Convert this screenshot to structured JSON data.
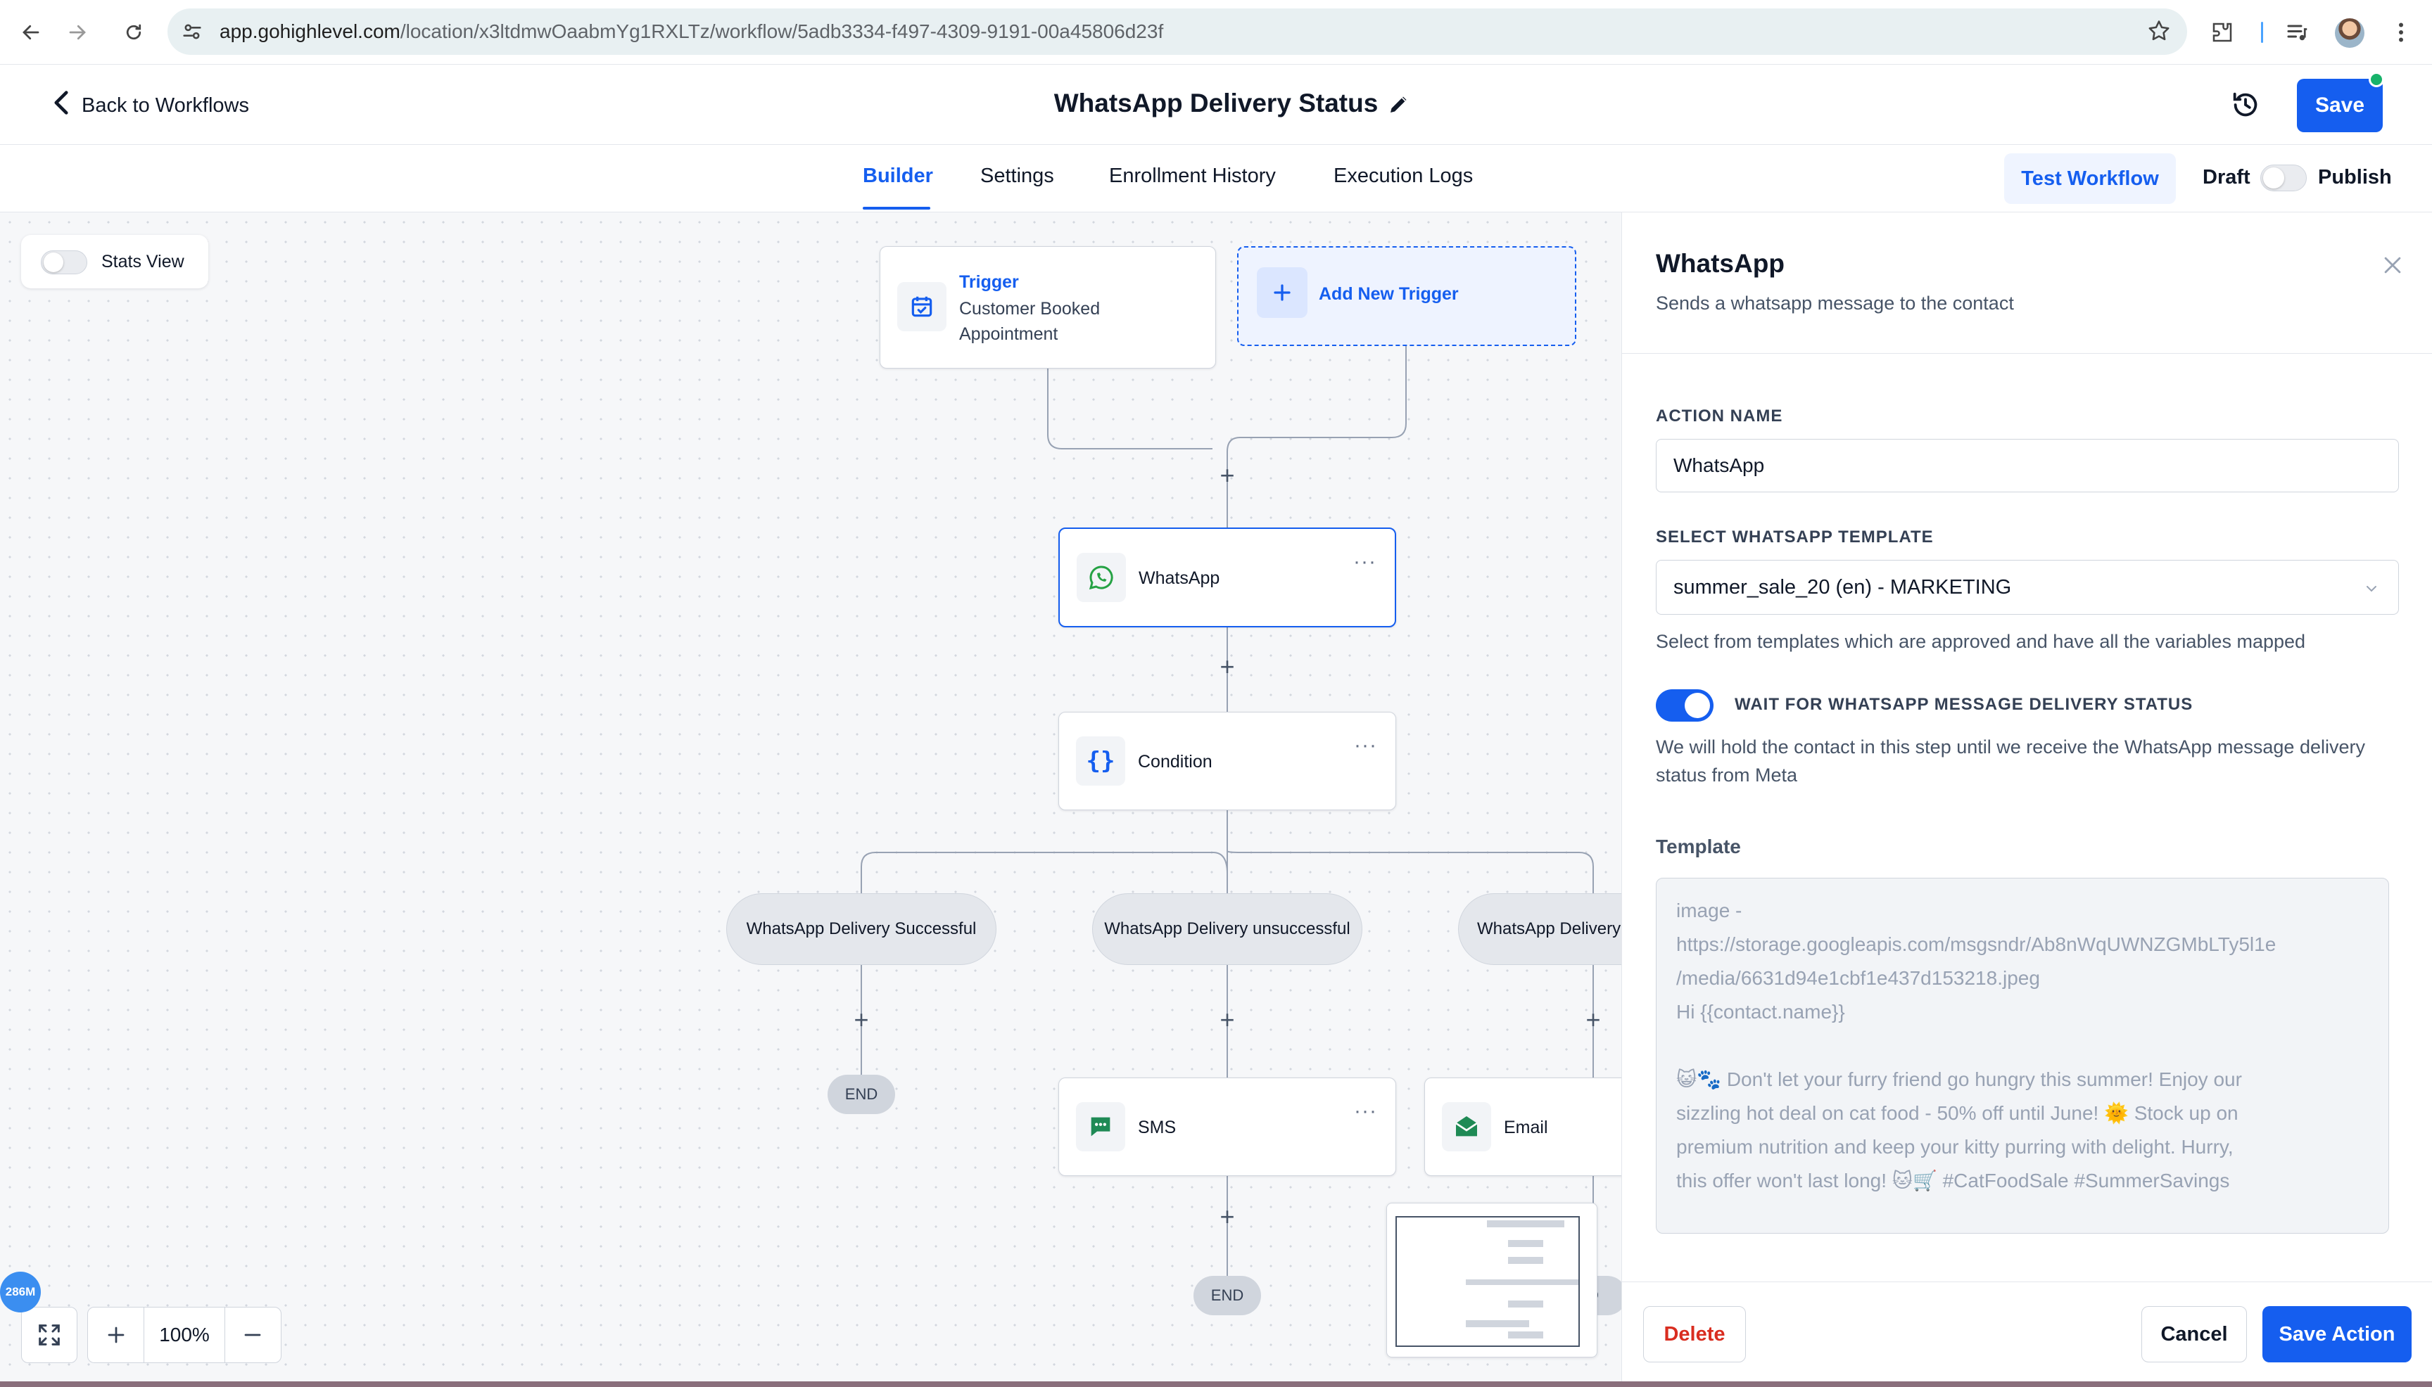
{
  "browser": {
    "url_host": "app.gohighlevel.com",
    "url_path": "/location/x3ltdmwOaabmYg1RXLTz/workflow/5adb3334-f497-4309-9191-00a45806d23f"
  },
  "header": {
    "back_label": "Back to Workflows",
    "title": "WhatsApp Delivery Status",
    "save_label": "Save"
  },
  "tabs": [
    {
      "label": "Builder",
      "active": true
    },
    {
      "label": "Settings",
      "active": false
    },
    {
      "label": "Enrollment History",
      "active": false
    },
    {
      "label": "Execution Logs",
      "active": false
    }
  ],
  "toolbar": {
    "test_label": "Test Workflow",
    "draft_label": "Draft",
    "publish_label": "Publish"
  },
  "canvas": {
    "stats_label": "Stats View",
    "trigger": {
      "kind": "Trigger",
      "name": "Customer Booked Appointment"
    },
    "add_trigger_label": "Add New Trigger",
    "whatsapp_node": "WhatsApp",
    "condition_node": "Condition",
    "branches": [
      "WhatsApp Delivery Successful",
      "WhatsApp Delivery unsuccessful",
      "WhatsApp Delivery Failed"
    ],
    "sms_node": "SMS",
    "email_node": "Email",
    "end_label": "END",
    "end_partial": "D",
    "zoom": "100%",
    "memory_badge": "286M"
  },
  "panel": {
    "title": "WhatsApp",
    "subtitle": "Sends a whatsapp message to the contact",
    "action_name_label": "ACTION NAME",
    "action_name_value": "WhatsApp",
    "template_select_label": "SELECT WHATSAPP TEMPLATE",
    "template_select_value": "summer_sale_20 (en) - MARKETING",
    "template_select_help": "Select from templates which are approved and have all the variables mapped",
    "wait_label": "WAIT FOR WHATSAPP MESSAGE DELIVERY STATUS",
    "wait_enabled": true,
    "wait_help": "We will hold the contact in this step until we receive the WhatsApp message delivery status from Meta",
    "template_label": "Template",
    "template_lines": [
      "image -",
      "https://storage.googleapis.com/msgsndr/Ab8nWqUWNZGMbLTy5l1e",
      "/media/6631d94e1cbf1e437d153218.jpeg",
      "Hi {{contact.name}}",
      "",
      "😺🐾 Don't let your furry friend go hungry this summer! Enjoy our",
      "sizzling hot deal on cat food - 50% off until June! 🌞 Stock up on",
      "premium nutrition and keep your kitty purring with delight. Hurry,",
      "this offer won't last long! 🐱🛒 #CatFoodSale #SummerSavings"
    ],
    "delete_label": "Delete",
    "cancel_label": "Cancel",
    "save_action_label": "Save Action"
  },
  "colors": {
    "primary": "#155eef",
    "danger": "#d92d20",
    "success": "#17b26a",
    "whatsapp_green": "#25a244"
  }
}
